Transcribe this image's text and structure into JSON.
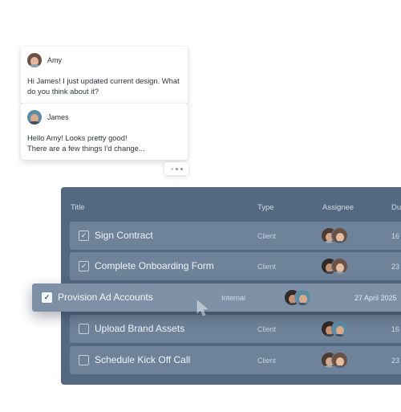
{
  "chat": {
    "messages": [
      {
        "sender": "Amy",
        "text": "Hi James! I just updated current design. What do you think about it?"
      },
      {
        "sender": "James",
        "text_line1": "Hello Amy! Looks pretty good!",
        "text_line2": "There are a few things I'd change..."
      }
    ],
    "typing_indicator": "..."
  },
  "tasks": {
    "columns": {
      "title": "Title",
      "type": "Type",
      "assignee": "Assignee",
      "due": "Du"
    },
    "rows": [
      {
        "title": "Sign Contract",
        "type": "Client",
        "due": "16",
        "checked": true
      },
      {
        "title": "Complete Onboarding Form",
        "type": "Client",
        "due": "23",
        "checked": true
      },
      {
        "title": "Upload Brand Assets",
        "type": "Client",
        "due": "16",
        "checked": false
      },
      {
        "title": "Schedule Kick Off Call",
        "type": "Client",
        "due": "23",
        "checked": false
      }
    ],
    "dragged_row": {
      "title": "Provision Ad Accounts",
      "type": "Internal",
      "due": "27 April 2025",
      "checked": true
    }
  },
  "icons": {
    "check": "check-icon",
    "avatar": "avatar-icon"
  },
  "colors": {
    "panel": "#536982",
    "row": "#6e8299",
    "dragged_row": "#7d90a5"
  }
}
